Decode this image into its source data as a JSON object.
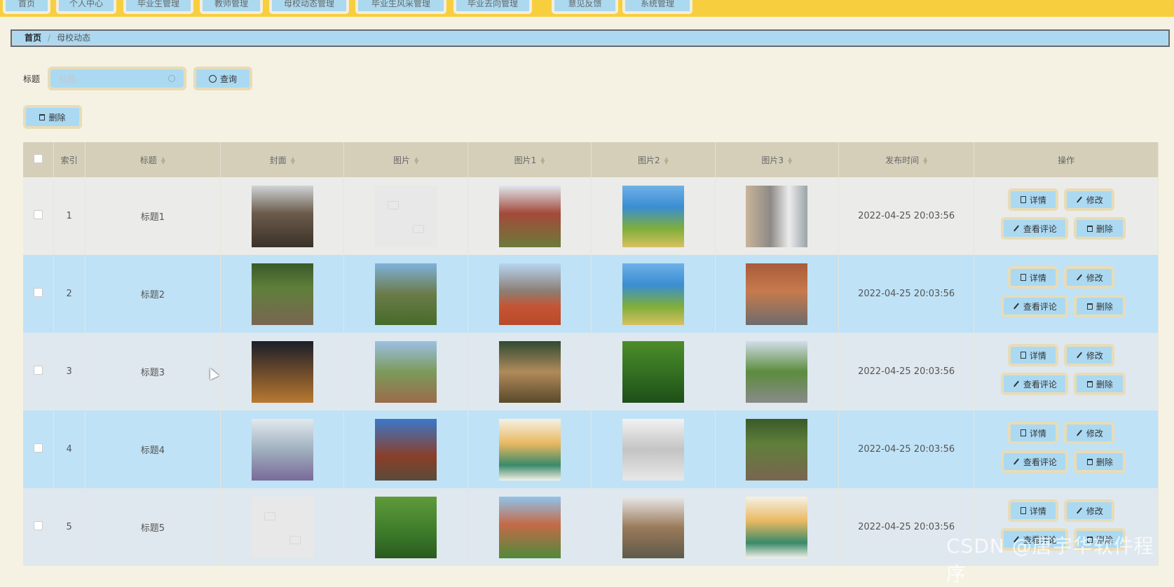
{
  "nav": {
    "items": [
      "首页",
      "个人中心",
      "毕业生管理",
      "教师管理",
      "母校动态管理",
      "毕业生风采管理",
      "毕业去向管理",
      "意见反馈",
      "系统管理"
    ]
  },
  "breadcrumb": {
    "home": "首页",
    "current": "母校动态"
  },
  "search": {
    "label": "标题",
    "placeholder": "标题",
    "button": "查询"
  },
  "toolbar": {
    "delete": "删除"
  },
  "table": {
    "columns": [
      "索引",
      "标题",
      "封面",
      "图片",
      "图片1",
      "图片2",
      "图片3",
      "发布时间",
      "操作"
    ],
    "actions": {
      "detail": "详情",
      "edit": "修改",
      "comments": "查看评论",
      "delete": "删除"
    },
    "rows": [
      {
        "index": "1",
        "title": "标题1",
        "time": "2022-04-25 20:03:56"
      },
      {
        "index": "2",
        "title": "标题2",
        "time": "2022-04-25 20:03:56"
      },
      {
        "index": "3",
        "title": "标题3",
        "time": "2022-04-25 20:03:56"
      },
      {
        "index": "4",
        "title": "标题4",
        "time": "2022-04-25 20:03:56"
      },
      {
        "index": "5",
        "title": "标题5",
        "time": "2022-04-25 20:03:56"
      }
    ]
  },
  "watermark": "CSDN @唐宇华软件程序",
  "colors": {
    "nav": "#f7cf3e",
    "accent": "#abd9f2",
    "border": "#e7dcb8",
    "bg": "#f5f2e4",
    "header": "#d5cfba"
  }
}
